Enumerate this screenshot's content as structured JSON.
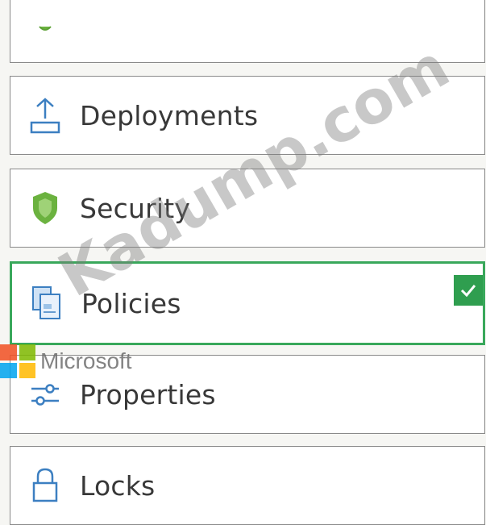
{
  "menu": {
    "items": [
      {
        "label": "",
        "icon": "security-icon-partial"
      },
      {
        "label": "Deployments",
        "icon": "upload-icon"
      },
      {
        "label": "Security",
        "icon": "shield-icon"
      },
      {
        "label": "Policies",
        "icon": "policy-document-icon",
        "selected": true
      },
      {
        "label": "Properties",
        "icon": "sliders-icon"
      },
      {
        "label": "Locks",
        "icon": "lock-icon"
      }
    ]
  },
  "selection_check": {
    "icon": "checkmark-icon",
    "color": "#2f9e4f"
  },
  "overlay": {
    "logo_text": "Microsoft",
    "watermark_text": "Kadump.com"
  },
  "colors": {
    "selected_border": "#39a85b",
    "icon_blue": "#3c7fc1",
    "shield_green": "#6bb23f"
  }
}
